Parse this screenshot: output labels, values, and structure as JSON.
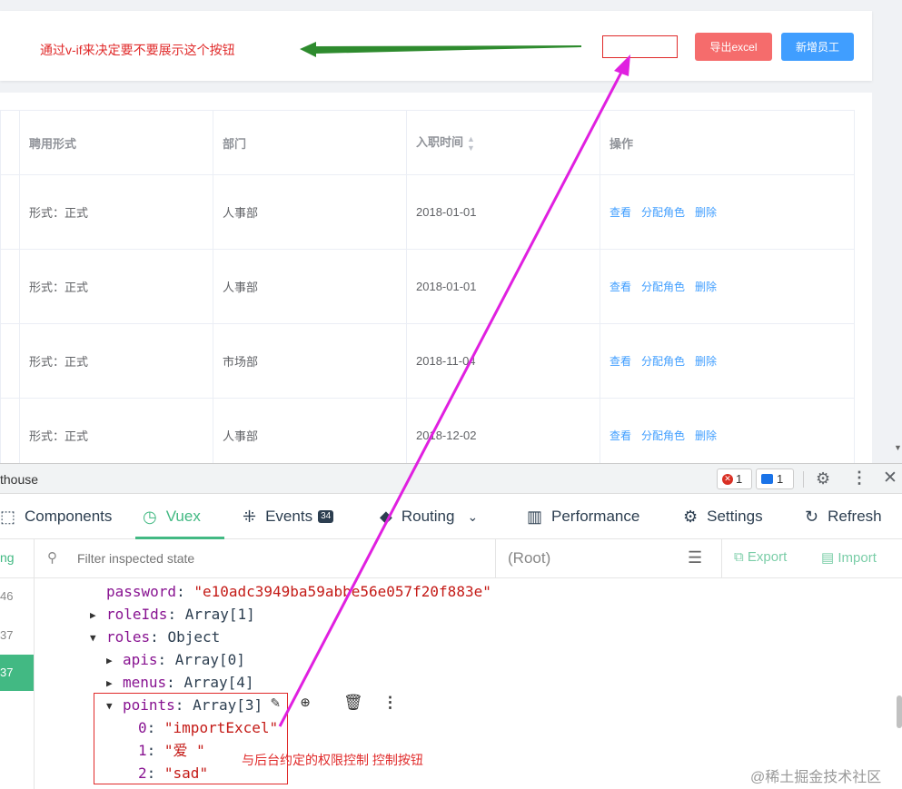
{
  "annotations": {
    "top_note": "通过v-if来决定要不要展示这个按钮",
    "bottom_note": "与后台约定的权限控制 控制按钮",
    "watermark": "@稀土掘金技术社区",
    "colors": {
      "annotation_red": "#e02a2a",
      "green_arrow": "#2e8b2e",
      "magenta_arrow": "#e020e0"
    }
  },
  "toolbar": {
    "export_label": "导出excel",
    "add_label": "新增员工",
    "colors": {
      "export": "#f56c6c",
      "add": "#409eff"
    }
  },
  "table": {
    "headers": [
      "聘用形式",
      "部门",
      "入职时间",
      "操作"
    ],
    "rows": [
      {
        "form": "形式：正式",
        "dept": "人事部",
        "date": "2018-01-01"
      },
      {
        "form": "形式：正式",
        "dept": "人事部",
        "date": "2018-01-01"
      },
      {
        "form": "形式：正式",
        "dept": "市场部",
        "date": "2018-11-04"
      },
      {
        "form": "形式：正式",
        "dept": "人事部",
        "date": "2018-12-02"
      }
    ],
    "actions": [
      "查看",
      "分配角色",
      "删除"
    ]
  },
  "devtools": {
    "title_fragment": "thouse",
    "error_count": "1",
    "message_count": "1",
    "tabs": [
      {
        "label": "Components",
        "icon": "components-icon"
      },
      {
        "label": "Vuex",
        "icon": "history-icon"
      },
      {
        "label": "Events",
        "icon": "dots-grid-icon",
        "count": "34"
      },
      {
        "label": "Routing",
        "icon": "diamond-route-icon"
      },
      {
        "label": "Performance",
        "icon": "bar-chart-icon"
      },
      {
        "label": "Settings",
        "icon": "gear-icon"
      },
      {
        "label": "Refresh",
        "icon": "refresh-icon"
      }
    ],
    "active_tab": "Vuex",
    "left_pane_label": "ng",
    "left_rows": [
      "46",
      "37",
      "37"
    ],
    "filter_placeholder": "Filter inspected state",
    "root_label": "(Root)",
    "export_label": "Export",
    "import_label": "Import",
    "state": {
      "password_key": "password",
      "password_value": "\"e10adc3949ba59abbe56e057f20f883e\"",
      "roleIds_key": "roleIds",
      "roleIds_value": "Array[1]",
      "roles_key": "roles",
      "roles_value": "Object",
      "apis_key": "apis",
      "apis_value": "Array[0]",
      "menus_key": "menus",
      "menus_value": "Array[4]",
      "points_key": "points",
      "points_value": "Array[3]",
      "points_items": [
        {
          "index": "0",
          "value": "\"importExcel\""
        },
        {
          "index": "1",
          "value": "\"爱 \""
        },
        {
          "index": "2",
          "value": "\"sad\""
        }
      ]
    }
  }
}
